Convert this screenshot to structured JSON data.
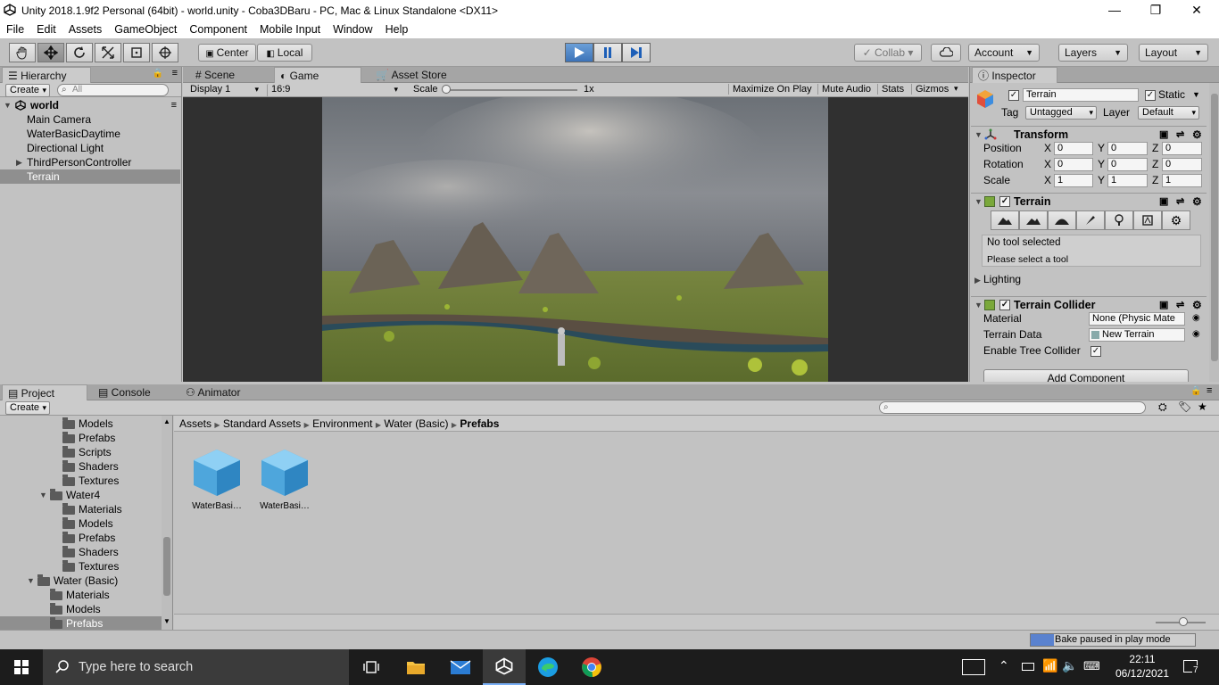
{
  "window": {
    "title": "Unity 2018.1.9f2 Personal (64bit) - world.unity - Coba3DBaru - PC, Mac & Linux Standalone <DX11>"
  },
  "menu": [
    "File",
    "Edit",
    "Assets",
    "GameObject",
    "Component",
    "Mobile Input",
    "Window",
    "Help"
  ],
  "toolbar": {
    "pivot": "Center",
    "space": "Local",
    "collab": "Collab ▾",
    "account": "Account",
    "layers": "Layers",
    "layout": "Layout"
  },
  "hierarchy": {
    "tab": "Hierarchy",
    "create": "Create",
    "search_placeholder": "All",
    "scene": "world",
    "items": [
      "Main Camera",
      "WaterBasicDaytime",
      "Directional Light",
      "ThirdPersonController",
      "Terrain"
    ],
    "selected": "Terrain"
  },
  "viewtabs": {
    "scene": "Scene",
    "game": "Game",
    "asset_store": "Asset Store"
  },
  "gamebar": {
    "display": "Display 1",
    "aspect": "16:9",
    "scale_label": "Scale",
    "scale_value": "1x",
    "maximize": "Maximize On Play",
    "mute": "Mute Audio",
    "stats": "Stats",
    "gizmos": "Gizmos"
  },
  "inspector": {
    "tab": "Inspector",
    "name": "Terrain",
    "static": "Static",
    "tag_label": "Tag",
    "tag": "Untagged",
    "layer_label": "Layer",
    "layer": "Default",
    "transform": {
      "title": "Transform",
      "position_label": "Position",
      "rotation_label": "Rotation",
      "scale_label": "Scale",
      "x": "X",
      "y": "Y",
      "z": "Z",
      "position": [
        "0",
        "0",
        "0"
      ],
      "rotation": [
        "0",
        "0",
        "0"
      ],
      "scale": [
        "1",
        "1",
        "1"
      ]
    },
    "terrain": {
      "title": "Terrain",
      "msg1": "No tool selected",
      "msg2": "Please select a tool",
      "lighting": "Lighting"
    },
    "collider": {
      "title": "Terrain Collider",
      "material_label": "Material",
      "material": "None (Physic Mate",
      "data_label": "Terrain Data",
      "data": "New Terrain",
      "tree_label": "Enable Tree Collider"
    },
    "add_component": "Add Component"
  },
  "bottomtabs": {
    "project": "Project",
    "console": "Console",
    "animator": "Animator"
  },
  "project": {
    "create": "Create",
    "tree": [
      {
        "label": "Models",
        "indent": 3
      },
      {
        "label": "Prefabs",
        "indent": 3
      },
      {
        "label": "Scripts",
        "indent": 3
      },
      {
        "label": "Shaders",
        "indent": 3
      },
      {
        "label": "Textures",
        "indent": 3
      },
      {
        "label": "Water4",
        "indent": 2,
        "open": true
      },
      {
        "label": "Materials",
        "indent": 3
      },
      {
        "label": "Models",
        "indent": 3
      },
      {
        "label": "Prefabs",
        "indent": 3
      },
      {
        "label": "Shaders",
        "indent": 3
      },
      {
        "label": "Textures",
        "indent": 3
      },
      {
        "label": "Water (Basic)",
        "indent": 1,
        "open": true
      },
      {
        "label": "Materials",
        "indent": 2
      },
      {
        "label": "Models",
        "indent": 2
      },
      {
        "label": "Prefabs",
        "indent": 2,
        "selected": true
      }
    ],
    "breadcrumb": [
      "Assets",
      "Standard Assets",
      "Environment",
      "Water (Basic)",
      "Prefabs"
    ],
    "assets": [
      "WaterBasi…",
      "WaterBasi…"
    ]
  },
  "status": {
    "bake": "Bake paused in play mode"
  },
  "taskbar": {
    "search_placeholder": "Type here to search",
    "time": "22:11",
    "date": "06/12/2021",
    "notifications": "7"
  }
}
